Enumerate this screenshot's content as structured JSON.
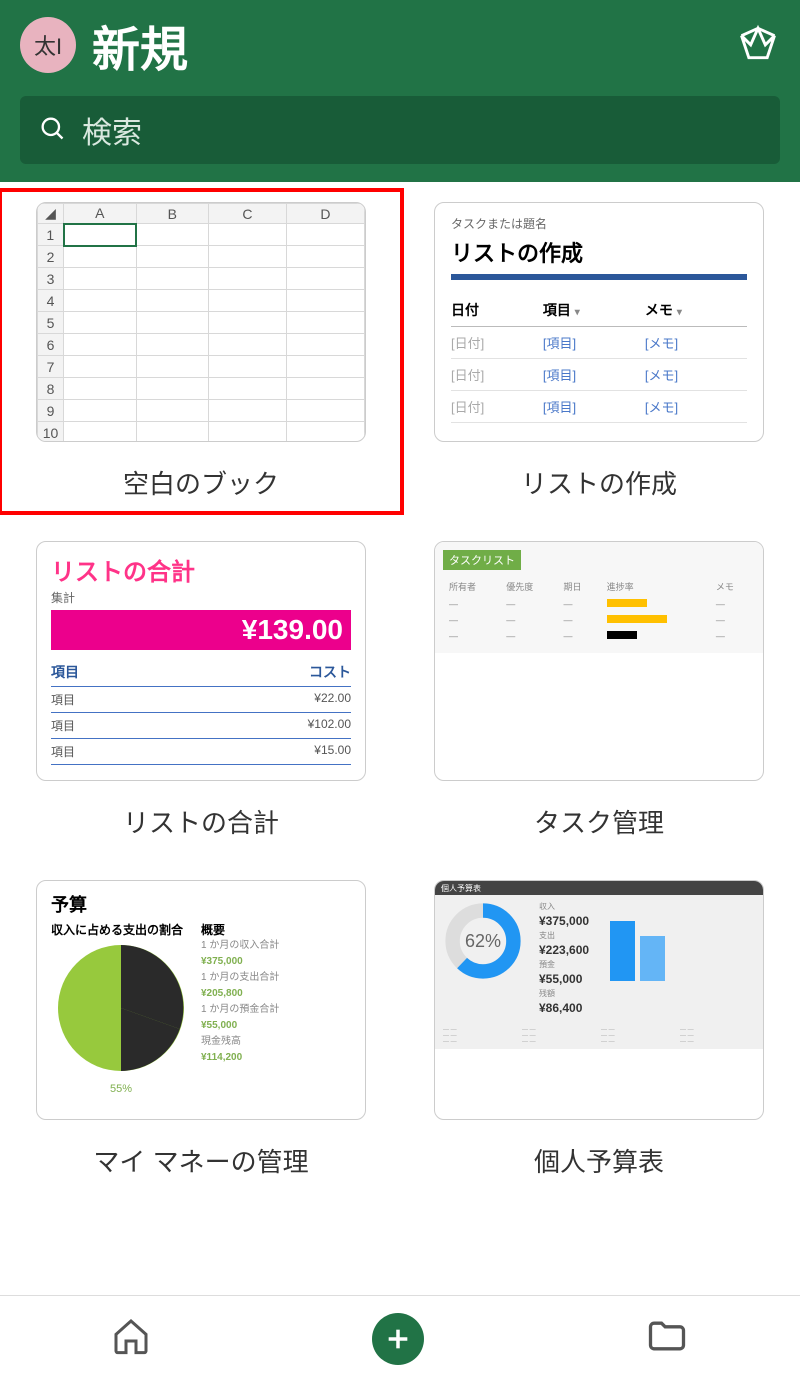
{
  "header": {
    "avatar": "太I",
    "title": "新規",
    "search_placeholder": "検索"
  },
  "templates": {
    "blank": {
      "caption": "空白のブック",
      "cols": [
        "A",
        "B",
        "C",
        "D"
      ],
      "rows": [
        "1",
        "2",
        "3",
        "4",
        "5",
        "6",
        "7",
        "8",
        "9",
        "10"
      ]
    },
    "list_create": {
      "caption": "リストの作成",
      "small": "タスクまたは題名",
      "title": "リストの作成",
      "headers": [
        "日付",
        "項目",
        "メモ"
      ],
      "cells": [
        "[日付]",
        "[項目]",
        "[メモ]"
      ]
    },
    "list_total": {
      "caption": "リストの合計",
      "title": "リストの合計",
      "sub": "集計",
      "total": "¥139.00",
      "head_item": "項目",
      "head_cost": "コスト",
      "rows": [
        {
          "item": "項目",
          "cost": "¥22.00"
        },
        {
          "item": "項目",
          "cost": "¥102.00"
        },
        {
          "item": "項目",
          "cost": "¥15.00"
        }
      ]
    },
    "task_manage": {
      "caption": "タスク管理",
      "title": "タスクリスト",
      "headers": [
        "所有者",
        "優先度",
        "期日",
        "進捗率",
        "メモ"
      ]
    },
    "my_money": {
      "caption": "マイ マネーの管理",
      "title": "予算",
      "sub": "収入に占める支出の割合",
      "overview": "概要",
      "pct": "55%",
      "lines": [
        {
          "label": "1 か月の収入合計",
          "val": "¥375,000"
        },
        {
          "label": "1 か月の支出合計",
          "val": "¥205,800"
        },
        {
          "label": "1 か月の預金合計",
          "val": "¥55,000"
        },
        {
          "label": "現金残高",
          "val": "¥114,200"
        }
      ]
    },
    "personal_budget": {
      "caption": "個人予算表",
      "title": "個人予算表",
      "pct": "62%",
      "figs": [
        {
          "label": "収入",
          "val": "¥375,000"
        },
        {
          "label": "支出",
          "val": "¥223,600"
        },
        {
          "label": "預金",
          "val": "¥55,000"
        },
        {
          "label": "残額",
          "val": "¥86,400"
        }
      ]
    }
  }
}
